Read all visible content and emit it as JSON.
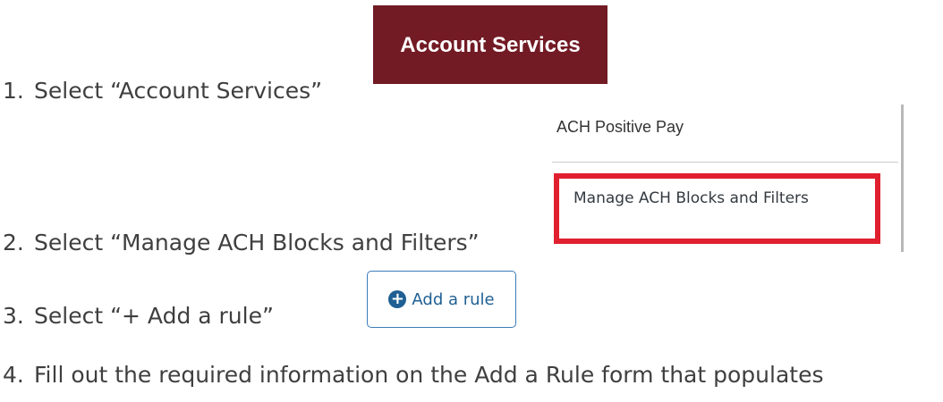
{
  "steps": [
    {
      "number": "1.",
      "text": "Select “Account Services”"
    },
    {
      "number": "2.",
      "text": "Select “Manage ACH Blocks and Filters”"
    },
    {
      "number": "3.",
      "text": "Select “+ Add a rule”"
    },
    {
      "number": "4.",
      "text": "Fill out the required information on the Add a Rule form that populates"
    }
  ],
  "account_services_button": {
    "label": "Account Services",
    "bg_color": "#721b25"
  },
  "menu": {
    "items": [
      {
        "label": "ACH Positive Pay"
      },
      {
        "label": "Manage ACH Blocks and Filters",
        "highlighted": true
      }
    ],
    "highlight_color": "#e0202f"
  },
  "add_rule_button": {
    "label": "Add a rule",
    "icon": "plus-circle-icon",
    "color": "#1f5f93"
  }
}
